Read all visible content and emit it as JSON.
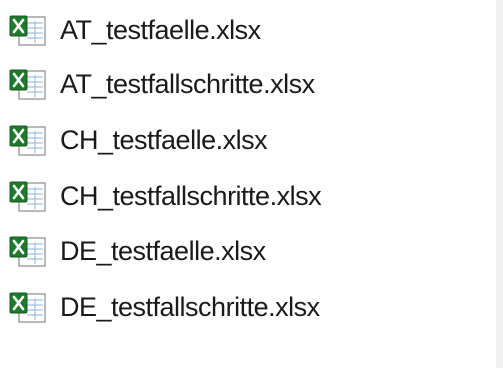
{
  "files": [
    {
      "name": "AT_testfaelle.xlsx",
      "icon": "excel-file-icon"
    },
    {
      "name": "AT_testfallschritte.xlsx",
      "icon": "excel-file-icon"
    },
    {
      "name": "CH_testfaelle.xlsx",
      "icon": "excel-file-icon"
    },
    {
      "name": "CH_testfallschritte.xlsx",
      "icon": "excel-file-icon"
    },
    {
      "name": "DE_testfaelle.xlsx",
      "icon": "excel-file-icon"
    },
    {
      "name": "DE_testfallschritte.xlsx",
      "icon": "excel-file-icon"
    }
  ],
  "colors": {
    "excel_green": "#1f7a2e",
    "sheet_grid": "#8fb3d9",
    "text": "#1a1a1a"
  }
}
